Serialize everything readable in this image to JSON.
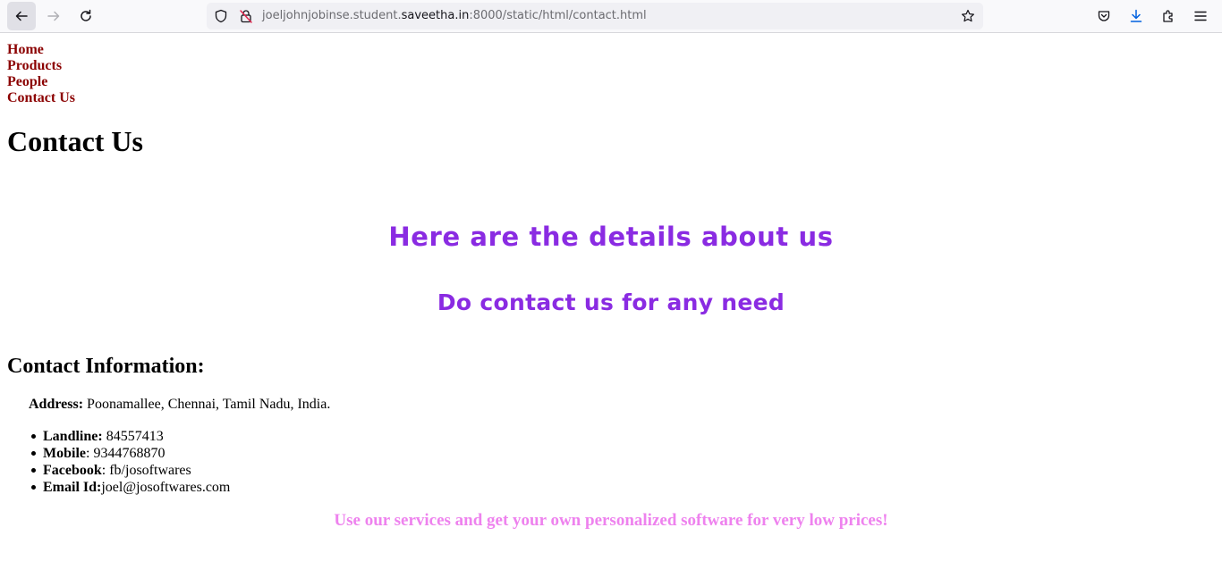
{
  "browser": {
    "url_prefix": "joeljohnjobinse.student.",
    "url_host": "saveetha.in",
    "url_suffix": ":8000/static/html/contact.html"
  },
  "nav": {
    "items": [
      {
        "label": "Home"
      },
      {
        "label": "Products"
      },
      {
        "label": "People"
      },
      {
        "label": "Contact Us"
      }
    ]
  },
  "page": {
    "title": "Contact Us",
    "heading_details": "Here are the details about us",
    "heading_need": "Do contact us for any need",
    "info_title": "Contact Information:",
    "address_label": "Address:",
    "address_value": " Poonamallee, Chennai, Tamil Nadu, India.",
    "contacts": [
      {
        "label": "Landline:",
        "value": " 84557413"
      },
      {
        "label": "Mobile",
        "value": ": 9344768870"
      },
      {
        "label": "Facebook",
        "value": ": fb/josoftwares"
      },
      {
        "label": "Email Id:",
        "value": "joel@josoftwares.com"
      }
    ],
    "promo": "Use our services and get your own personalized software for very low prices!"
  },
  "colors": {
    "nav_link": "#8b0000",
    "heading_purple": "#8a2be2",
    "promo_violet": "#ee82ee"
  }
}
